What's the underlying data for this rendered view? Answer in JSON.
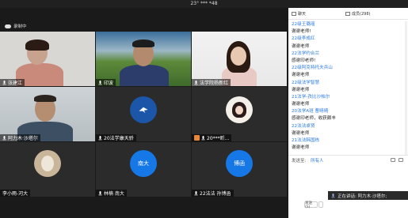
{
  "window": {
    "title": "23° *** *48"
  },
  "recording": {
    "label": "录制中"
  },
  "tiles": [
    {
      "name": "张建江"
    },
    {
      "name": "印波"
    },
    {
      "name": "法学院杨新红"
    },
    {
      "name": "阿力木·沙塔尔"
    },
    {
      "name": "20法学康天骄"
    },
    {
      "name": "20***昕..."
    },
    {
      "name": "李小雨-河大"
    },
    {
      "name": "林楠 南大",
      "avatar": "南大"
    },
    {
      "name": "22法法 孙博函",
      "avatar": "博函"
    }
  ],
  "chat": {
    "tab_label": "聊天",
    "members_label": "成员(298)",
    "messages": [
      {
        "type": "name",
        "text": "22级王璐瑶"
      },
      {
        "type": "text",
        "text": "谢谢老师!"
      },
      {
        "type": "name",
        "text": "22级李成红"
      },
      {
        "type": "text",
        "text": "谢谢老师"
      },
      {
        "type": "name",
        "text": "22法学约合兰"
      },
      {
        "type": "text",
        "text": "感谢印老师!"
      },
      {
        "type": "name",
        "text": "22级阿克特托夫兵山"
      },
      {
        "type": "text",
        "text": "谢谢老师"
      },
      {
        "type": "name",
        "text": "22级法学智慧"
      },
      {
        "type": "text",
        "text": "谢谢老师"
      },
      {
        "type": "name",
        "text": "21法学-孜比沙帕尔"
      },
      {
        "type": "text",
        "text": "谢谢老师"
      },
      {
        "type": "name",
        "text": "20法学A班 曹晴晴"
      },
      {
        "type": "text",
        "text": "感谢印老师，收获颇丰"
      },
      {
        "type": "name",
        "text": "22法法卓贤"
      },
      {
        "type": "text",
        "text": "谢谢老师"
      },
      {
        "type": "name",
        "text": "21法法韩国栋"
      },
      {
        "type": "text",
        "text": "谢谢老师"
      }
    ],
    "send_to_label": "发送至:",
    "recipient": "所有人",
    "send_button": "发送(S)"
  },
  "speaking": {
    "text": "正在讲话: 阿力木·沙塔尔;"
  }
}
